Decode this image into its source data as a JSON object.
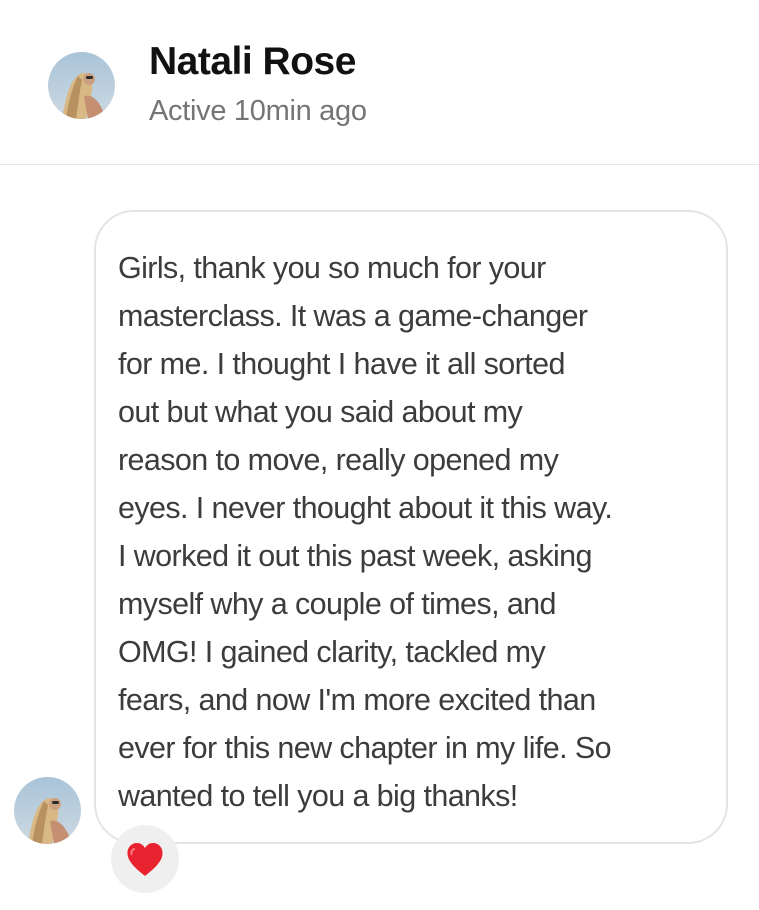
{
  "contact": {
    "name": "Natali Rose",
    "status": "Active 10min ago",
    "avatar_icon": "profile-photo"
  },
  "message": {
    "text": "Girls, thank you so much for your\nmasterclass. It was a game-changer\nfor me. I thought I have it all sorted\nout but what you said about my\nreason to move, really opened my\neyes. I never thought about it this way.\nI worked it out this past week, asking\nmyself why a couple of times, and\nOMG! I gained clarity, tackled my\nfears, and now I'm more excited than\never for this new chapter in my life. So\nwanted to tell you a big thanks!",
    "reaction_icon": "heart-icon"
  },
  "colors": {
    "reaction_heart": "#e8232f",
    "bubble_border": "#e4e4e4",
    "reaction_background": "#efefef"
  }
}
